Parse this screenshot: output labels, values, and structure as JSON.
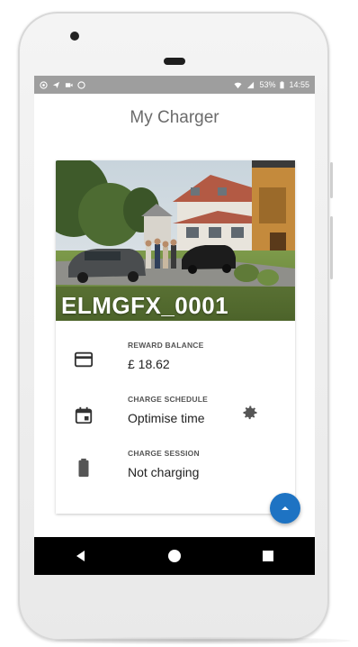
{
  "status_bar": {
    "left_icons": [
      "whatsapp-icon",
      "send-icon",
      "video-icon",
      "circle-icon"
    ],
    "battery_text": "53%",
    "time": "14:55"
  },
  "app": {
    "title": "My Charger"
  },
  "charger": {
    "id": "ELMGFX_0001",
    "image": "house-with-electric-cars-photo"
  },
  "reward": {
    "label": "REWARD BALANCE",
    "value": "£ 18.62",
    "icon": "credit-card-icon"
  },
  "schedule": {
    "label": "CHARGE SCHEDULE",
    "value": "Optimise time",
    "icon": "calendar-icon",
    "settings_icon": "gear-icon"
  },
  "session": {
    "label": "CHARGE SESSION",
    "value": "Not charging",
    "icon": "battery-icon"
  },
  "fab": {
    "icon": "chevron-up-icon"
  },
  "navigation": [
    "back-icon",
    "home-icon",
    "recents-icon"
  ],
  "colors": {
    "status_bar": "#9e9e9e",
    "fab": "#1e73c3",
    "nav_bar": "#000000",
    "title": "#6b6b6b"
  }
}
